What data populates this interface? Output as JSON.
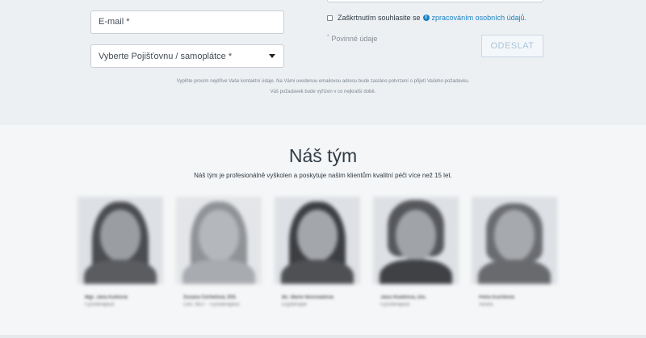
{
  "form": {
    "email_placeholder": "E-mail *",
    "insurer_select_value": "Vyberte Pojišťovnu / samoplátce *",
    "consent_text": "Zaškrtnutím souhlasite se",
    "consent_link": "zpracováním osobních údajů.",
    "required_mark": "*",
    "required_text": "Povinné údaje",
    "submit_label": "ODESLAT",
    "note_line1": "Vyplňte prosím nejdříve Vaše kontaktní údaje. Na Vámi uvedenou emailovou adresu bude zasláno potvrzení o přijetí Vašeho požadavku.",
    "note_line2": "Váš požadavek bude vyřízen v co nejkratší době.",
    "info_icon": "info-circle-icon",
    "accent_color": "#1a82c4"
  },
  "team": {
    "title": "Náš tým",
    "subtitle": "Náš tým je profesionálně vyškolen a poskytuje našim klientům kvalitní péči více než 15 let.",
    "members": [
      {
        "name": "Mgr. Jana Kulhová",
        "role": "Fyzioterapeut"
      },
      {
        "name": "Zuzana Čerhelová, DiS.",
        "role": "Cert. MDT · Fyzioterapeut"
      },
      {
        "name": "Bc. Marie Novosádová",
        "role": "Ergoterapie"
      },
      {
        "name": "Jana Hradilová, Dis.",
        "role": "Fyzioterapeut"
      },
      {
        "name": "Petra Kuchtová",
        "role": "Sestra"
      }
    ]
  }
}
